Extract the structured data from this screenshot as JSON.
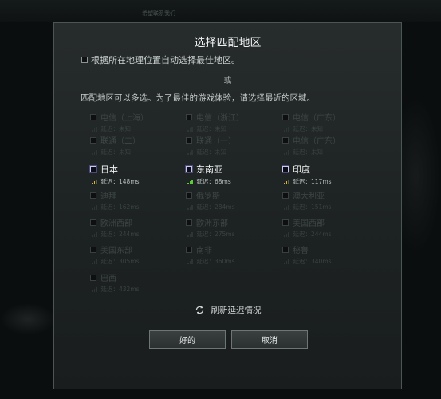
{
  "background": {
    "top_text": "希望联系我们"
  },
  "dialog": {
    "title": "选择匹配地区",
    "auto_select": "根据所在地理位置自动选择最佳地区。",
    "or": "或",
    "hint": "匹配地区可以多选。为了最佳的游戏体验，请选择最近的区域。",
    "regions": [
      {
        "name": "电信（上海）",
        "latency": "延迟：未知",
        "active": false
      },
      {
        "name": "电信（浙江）",
        "latency": "延迟：未知",
        "active": false
      },
      {
        "name": "电信（广东）",
        "latency": "延迟：未知",
        "active": false
      },
      {
        "name": "联通（二）",
        "latency": "延迟：未知",
        "active": false
      },
      {
        "name": "联通（一）",
        "latency": "延迟：未知",
        "active": false
      },
      {
        "name": "电信（广东）",
        "latency": "延迟：未知",
        "active": false
      },
      {
        "name": "日本",
        "latency": "延迟：148ms",
        "active": true,
        "signal": "yellow"
      },
      {
        "name": "东南亚",
        "latency": "延迟：68ms",
        "active": true,
        "signal": "green"
      },
      {
        "name": "印度",
        "latency": "延迟：117ms",
        "active": true,
        "signal": "yellow"
      },
      {
        "name": "迪拜",
        "latency": "延迟：162ms",
        "active": false
      },
      {
        "name": "俄罗斯",
        "latency": "延迟：284ms",
        "active": false
      },
      {
        "name": "澳大利亚",
        "latency": "延迟：151ms",
        "active": false
      },
      {
        "name": "欧洲西部",
        "latency": "延迟：244ms",
        "active": false
      },
      {
        "name": "欧洲东部",
        "latency": "延迟：275ms",
        "active": false
      },
      {
        "name": "美国西部",
        "latency": "延迟：244ms",
        "active": false
      },
      {
        "name": "美国东部",
        "latency": "延迟：305ms",
        "active": false
      },
      {
        "name": "南非",
        "latency": "延迟：360ms",
        "active": false
      },
      {
        "name": "秘鲁",
        "latency": "延迟：340ms",
        "active": false
      },
      {
        "name": "巴西",
        "latency": "延迟：432ms",
        "active": false
      }
    ],
    "refresh_label": "刷新延迟情况",
    "ok_label": "好的",
    "cancel_label": "取消"
  }
}
